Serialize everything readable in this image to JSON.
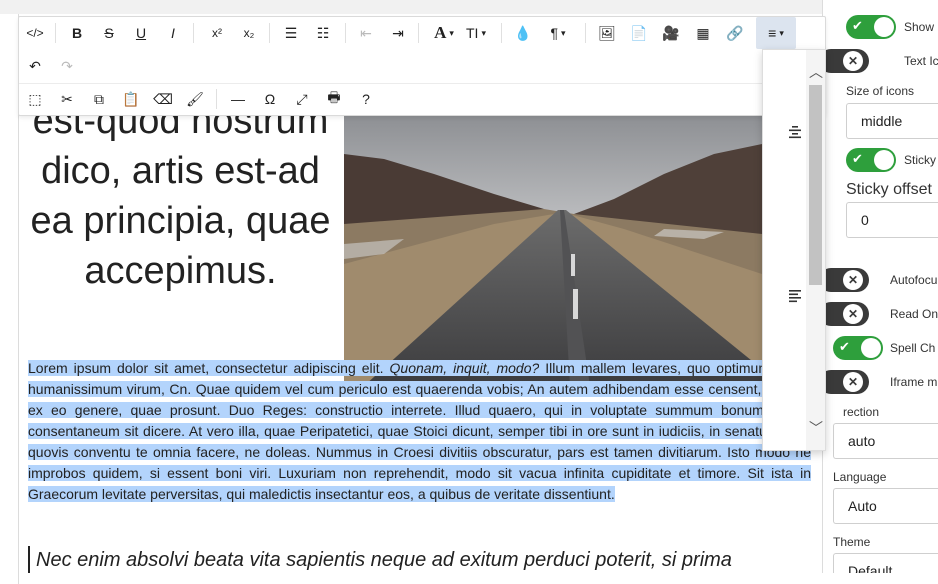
{
  "toolbar": {
    "row1": [
      {
        "name": "source-button",
        "icon": "source-icon",
        "glyph": "</>"
      },
      {
        "name": "bold-button",
        "icon": "bold-icon",
        "glyph": "B"
      },
      {
        "name": "strikethrough-button",
        "icon": "strikethrough-icon",
        "glyph": "S"
      },
      {
        "name": "underline-button",
        "icon": "underline-icon",
        "glyph": "U"
      },
      {
        "name": "italic-button",
        "icon": "italic-icon",
        "glyph": "I"
      },
      {
        "name": "superscript-button",
        "icon": "superscript-icon",
        "glyph": "x²"
      },
      {
        "name": "subscript-button",
        "icon": "subscript-icon",
        "glyph": "x₂"
      },
      {
        "name": "unordered-list-button",
        "icon": "bullet-list-icon",
        "glyph": "☰"
      },
      {
        "name": "ordered-list-button",
        "icon": "numbered-list-icon",
        "glyph": "☷"
      },
      {
        "name": "outdent-button",
        "icon": "outdent-icon",
        "glyph": "⇤"
      },
      {
        "name": "indent-button",
        "icon": "indent-icon",
        "glyph": "⇥"
      },
      {
        "name": "font-button",
        "icon": "font-icon",
        "glyph": "A"
      },
      {
        "name": "font-size-button",
        "icon": "font-size-icon",
        "glyph": "TI"
      },
      {
        "name": "color-button",
        "icon": "drop-icon",
        "glyph": "💧"
      },
      {
        "name": "paragraph-button",
        "icon": "paragraph-icon",
        "glyph": "¶"
      },
      {
        "name": "image-button",
        "icon": "image-icon",
        "glyph": "🖼"
      },
      {
        "name": "file-button",
        "icon": "file-icon",
        "glyph": "📄"
      },
      {
        "name": "video-button",
        "icon": "video-icon",
        "glyph": "🎥"
      },
      {
        "name": "table-button",
        "icon": "table-icon",
        "glyph": "▦"
      },
      {
        "name": "link-button",
        "icon": "link-icon",
        "glyph": "🔗"
      },
      {
        "name": "align-button",
        "icon": "align-icon",
        "glyph": "≡"
      }
    ],
    "row2": [
      {
        "name": "undo-button",
        "icon": "undo-icon",
        "glyph": "↶"
      },
      {
        "name": "redo-button",
        "icon": "redo-icon",
        "glyph": "↷"
      }
    ],
    "row3": [
      {
        "name": "select-all-button",
        "icon": "select-all-icon",
        "glyph": "⬚"
      },
      {
        "name": "cut-button",
        "icon": "scissors-icon",
        "glyph": "✂"
      },
      {
        "name": "copy-button",
        "icon": "copy-icon",
        "glyph": "⧉"
      },
      {
        "name": "paste-button",
        "icon": "paste-icon",
        "glyph": "📋"
      },
      {
        "name": "eraser-button",
        "icon": "eraser-icon",
        "glyph": "⌫"
      },
      {
        "name": "format-painter-button",
        "icon": "paint-roller-icon",
        "glyph": "🖌"
      },
      {
        "name": "horizontal-rule-button",
        "icon": "hr-icon",
        "glyph": "—"
      },
      {
        "name": "symbol-button",
        "icon": "omega-icon",
        "glyph": "Ω"
      },
      {
        "name": "fullsize-button",
        "icon": "expand-icon",
        "glyph": "⤢"
      },
      {
        "name": "print-button",
        "icon": "printer-icon",
        "glyph": "🖶"
      },
      {
        "name": "about-button",
        "icon": "help-icon",
        "glyph": "?"
      }
    ]
  },
  "dropdown": {
    "items": [
      {
        "name": "align-center-option",
        "icon": "align-center-icon"
      },
      {
        "name": "align-left-option",
        "icon": "align-left-icon"
      }
    ]
  },
  "content": {
    "heading": "est-quod nostrum dico, artis est-ad ea principia, quae accepimus.",
    "para_start": "Lorem ipsum dolor sit amet, consectetur adipiscing elit. ",
    "para_em": "Quonam, inquit, modo?",
    "para_rest": " Illum mallem levares, quo optimum atque humanissimum virum, Cn. Quae quidem vel cum periculo est quaerenda vobis; An autem adhibendam esse censent, quia sit ex eo genere, quae prosunt. Duo Reges: constructio interrete. Illud quaero, qui in voluptate summum bonum ponat, consentaneum sit dicere. At vero illa, quae Peripatetici, quae Stoici dicunt, semper tibi in ore sunt in iudiciis, in senatu. Dic in quovis conventu te omnia facere, ne doleas. Nummus in Croesi divitiis obscuratur, pars est tamen divitiarum. Isto modo ne improbos quidem, si essent boni viri. Luxuriam non reprehendit, modo sit vacua infinita cupiditate et timore. Sit ista in Graecorum levitate perversitas, qui maledictis insectantur eos, a quibus de veritate dissentiunt.",
    "quote": "Nec enim absolvi beata vita sapientis neque ad exitum perduci poterit, si prima"
  },
  "settings": {
    "show_label": "Show ",
    "text_icons_label": "Text Ic",
    "size_of_icons_label": "Size of icons",
    "size_of_icons_value": "middle",
    "sticky_label": "Sticky",
    "sticky_offset_label": "Sticky offset",
    "sticky_offset_value": "0",
    "autofocus_label": "Autofocu",
    "read_only_label": "Read On",
    "spellcheck_label": "Spell Ch",
    "iframe_label": "Iframe m",
    "direction_label": "rection",
    "direction_value": "auto",
    "language_label": "Language",
    "language_value": "Auto",
    "theme_label": "Theme",
    "theme_value": "Default"
  },
  "colors": {
    "selection": "#b3d4fc",
    "toggle_on": "#2e9f3c",
    "toggle_off": "#3a3a3a"
  }
}
